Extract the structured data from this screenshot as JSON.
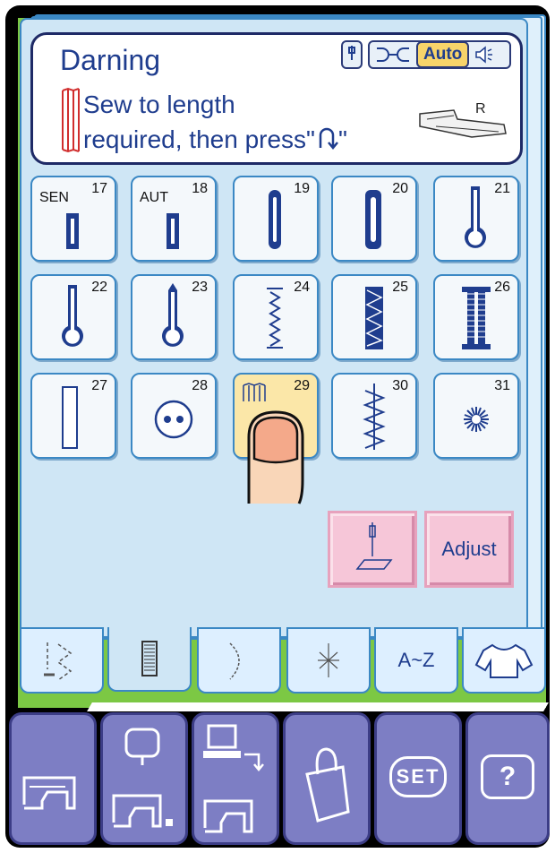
{
  "screen": {
    "title": "Darning",
    "message_line1": "Sew to length",
    "message_line2": "required, then press\"",
    "message_line2_end": "\"",
    "auto_label": "Auto",
    "foot_label": "R"
  },
  "stitches": [
    {
      "num": "17",
      "prefix": "SEN",
      "icon": "buttonhole-sensor-icon"
    },
    {
      "num": "18",
      "prefix": "AUT",
      "icon": "buttonhole-auto-icon"
    },
    {
      "num": "19",
      "prefix": "",
      "icon": "buttonhole-round-icon"
    },
    {
      "num": "20",
      "prefix": "",
      "icon": "buttonhole-square-icon"
    },
    {
      "num": "21",
      "prefix": "",
      "icon": "keyhole-buttonhole-icon"
    },
    {
      "num": "22",
      "prefix": "",
      "icon": "keyhole-buttonhole-icon"
    },
    {
      "num": "23",
      "prefix": "",
      "icon": "keyhole-pointed-icon"
    },
    {
      "num": "24",
      "prefix": "",
      "icon": "stretch-buttonhole-icon"
    },
    {
      "num": "25",
      "prefix": "",
      "icon": "knit-buttonhole-icon"
    },
    {
      "num": "26",
      "prefix": "",
      "icon": "bar-tack-buttonhole-icon"
    },
    {
      "num": "27",
      "prefix": "",
      "icon": "bound-buttonhole-icon"
    },
    {
      "num": "28",
      "prefix": "",
      "icon": "button-sewing-icon"
    },
    {
      "num": "29",
      "prefix": "",
      "icon": "darning-icon",
      "selected": true
    },
    {
      "num": "30",
      "prefix": "",
      "icon": "tacking-icon"
    },
    {
      "num": "31",
      "prefix": "",
      "icon": "eyelet-icon"
    }
  ],
  "adjust_label": "Adjust",
  "tabs": [
    {
      "label": "",
      "icon": "utility-stitch-icon"
    },
    {
      "label": "",
      "icon": "buttonhole-tab-icon"
    },
    {
      "label": "",
      "icon": "satin-stitch-icon"
    },
    {
      "label": "",
      "icon": "decorative-stitch-icon"
    },
    {
      "label": "A~Z",
      "icon": ""
    },
    {
      "label": "",
      "icon": "shirt-icon"
    }
  ],
  "bottom_set": "SET",
  "bottom_help": "?"
}
